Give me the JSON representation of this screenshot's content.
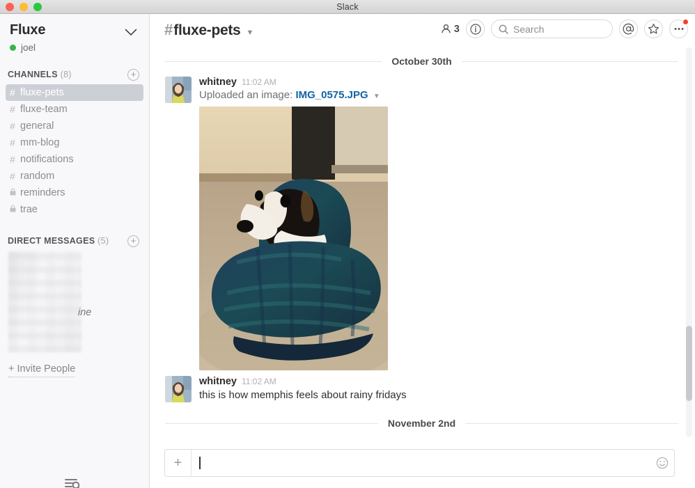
{
  "window": {
    "title": "Slack"
  },
  "sidebar": {
    "team_name": "Fluxe",
    "username": "joel",
    "presence": "online",
    "channels_section": {
      "title": "CHANNELS",
      "count": "(8)"
    },
    "channels": [
      {
        "label": "fluxe-pets",
        "sigil": "#",
        "private": false,
        "active": true
      },
      {
        "label": "fluxe-team",
        "sigil": "#",
        "private": false,
        "active": false
      },
      {
        "label": "general",
        "sigil": "#",
        "private": false,
        "active": false
      },
      {
        "label": "mm-blog",
        "sigil": "#",
        "private": false,
        "active": false
      },
      {
        "label": "notifications",
        "sigil": "#",
        "private": false,
        "active": false
      },
      {
        "label": "random",
        "sigil": "#",
        "private": false,
        "active": false
      },
      {
        "label": "reminders",
        "sigil": "\u0001",
        "private": true,
        "active": false
      },
      {
        "label": "trae",
        "sigil": "\u0001",
        "private": true,
        "active": false
      }
    ],
    "dms_section": {
      "title": "DIRECT MESSAGES",
      "count": "(5)"
    },
    "dm_fragment": "ine",
    "invite_label": "+ Invite People"
  },
  "header": {
    "channel_hash": "#",
    "channel_name": "fluxe-pets",
    "member_count": "3",
    "search_placeholder": "Search",
    "search_value": ""
  },
  "main": {
    "date_dividers": {
      "first": "October 30th",
      "second": "November 2nd"
    },
    "messages": [
      {
        "user": "whitney",
        "time": "11:02 AM",
        "upload_prefix": "Uploaded an image:",
        "file_name": "IMG_0575.JPG",
        "has_photo": true,
        "text": ""
      },
      {
        "user": "whitney",
        "time": "11:02 AM",
        "upload_prefix": "",
        "file_name": "",
        "has_photo": false,
        "text": "this is how memphis feels about rainy fridays"
      }
    ]
  },
  "composer": {
    "value": "",
    "placeholder": ""
  },
  "colors": {
    "link": "#1264a3",
    "presence_green": "#38b349",
    "notification_red": "#f4402f",
    "active_channel_bg": "#ccd0d6",
    "sidebar_bg": "#f8f8fa"
  }
}
